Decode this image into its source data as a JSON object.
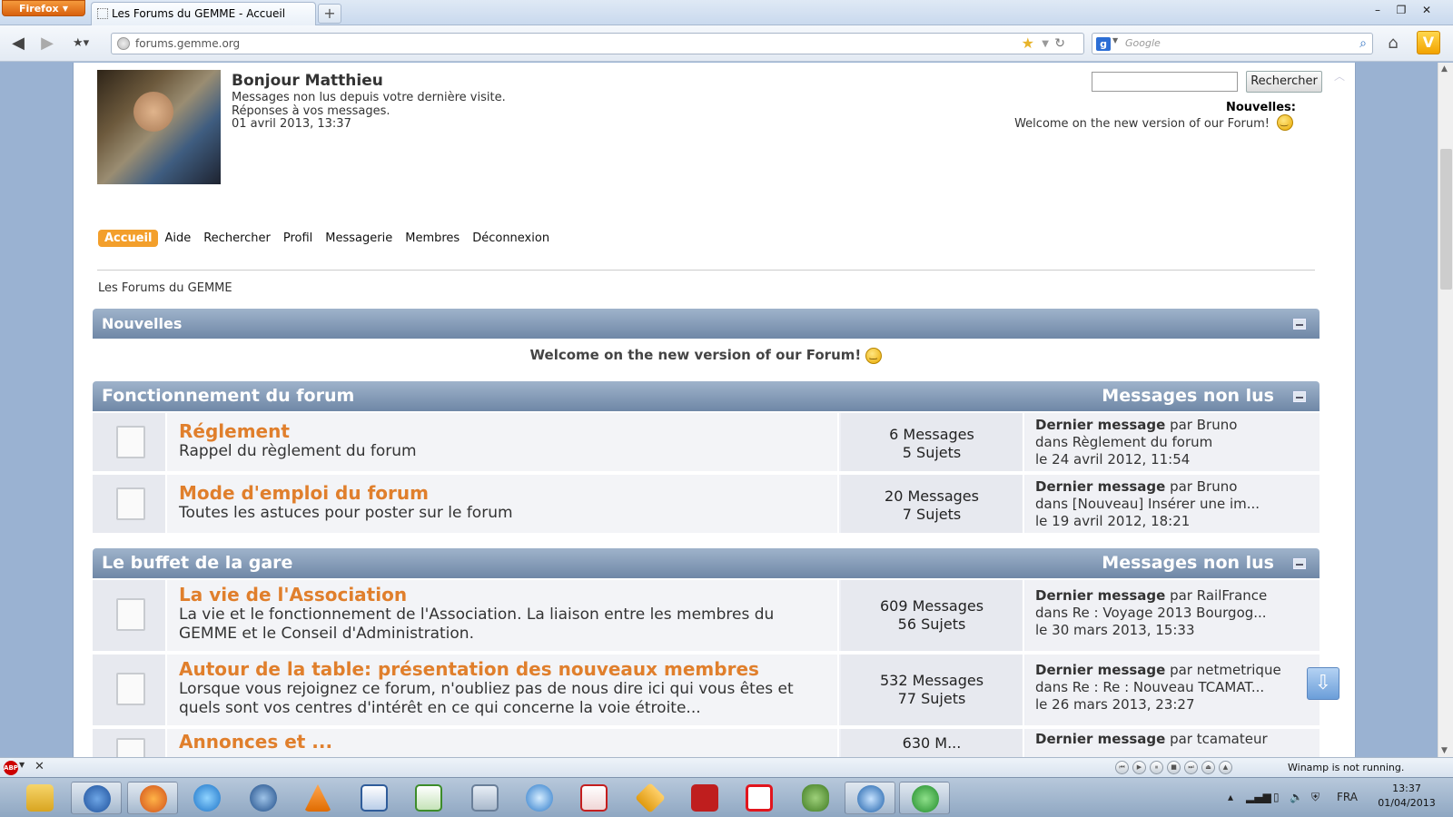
{
  "browser": {
    "app_button": "Firefox",
    "tab_title": "Les Forums du GEMME - Accueil",
    "url": "forums.gemme.org",
    "search_placeholder": "Google",
    "window_controls": [
      "minimize-icon",
      "restore-icon",
      "close-icon"
    ]
  },
  "header": {
    "greeting": "Bonjour Matthieu",
    "unread_link": "Messages non lus depuis votre dernière visite.",
    "replies_link": "Réponses à vos messages.",
    "datetime": "01 avril 2013, 13:37",
    "search_button": "Rechercher",
    "news_label": "Nouvelles:",
    "news_text": "Welcome on the new version of our Forum!"
  },
  "menu": [
    {
      "label": "Accueil",
      "active": true
    },
    {
      "label": "Aide"
    },
    {
      "label": "Rechercher"
    },
    {
      "label": "Profil"
    },
    {
      "label": "Messagerie"
    },
    {
      "label": "Membres"
    },
    {
      "label": "Déconnexion"
    }
  ],
  "breadcrumb": "Les Forums du GEMME",
  "news_section": {
    "title": "Nouvelles",
    "message": "Welcome on the new version of our Forum!"
  },
  "categories": [
    {
      "title": "Fonctionnement du forum",
      "unread_label": "Messages non lus",
      "boards": [
        {
          "title": "Réglement",
          "desc": "Rappel du règlement du forum",
          "messages": "6 Messages",
          "topics": "5 Sujets",
          "last_label": "Dernier message",
          "last_by": " par Bruno",
          "last_in": "dans Règlement du forum",
          "last_date": "le 24 avril 2012, 11:54"
        },
        {
          "title": "Mode d'emploi du forum",
          "desc": "Toutes les astuces pour poster sur le forum",
          "messages": "20 Messages",
          "topics": "7 Sujets",
          "last_label": "Dernier message",
          "last_by": " par Bruno",
          "last_in": "dans [Nouveau] Insérer une im...",
          "last_date": "le 19 avril 2012, 18:21"
        }
      ]
    },
    {
      "title": "Le buffet de la gare",
      "unread_label": "Messages non lus",
      "boards": [
        {
          "title": "La vie de l'Association",
          "desc": "La vie et le fonctionnement de l'Association. La liaison entre les membres du GEMME et le Conseil d'Administration.",
          "messages": "609 Messages",
          "topics": "56 Sujets",
          "last_label": "Dernier message",
          "last_by": " par RailFrance",
          "last_in": "dans Re : Voyage 2013 Bourgog...",
          "last_date": "le 30 mars 2013, 15:33"
        },
        {
          "title": "Autour de la table: présentation des nouveaux membres",
          "desc": "Lorsque vous rejoignez ce forum, n'oubliez pas de nous dire ici qui vous êtes et quels sont vos centres d'intérêt en ce qui concerne la voie étroite...",
          "messages": "532 Messages",
          "topics": "77 Sujets",
          "last_label": "Dernier message",
          "last_by": " par netmetrique",
          "last_in": "dans Re : Re : Nouveau TCAMAT...",
          "last_date": "le 26 mars 2013, 23:27"
        },
        {
          "title": "Annonces et ...",
          "desc": "",
          "messages": "630 M...",
          "topics": "",
          "last_label": "Dernier message",
          "last_by": " par tcamateur",
          "last_in": "",
          "last_date": ""
        }
      ]
    }
  ],
  "addon_bar": {
    "winamp_status": "Winamp is not running."
  },
  "taskbar": {
    "apps": [
      "file-explorer-icon",
      "thunderbird-icon",
      "firefox-icon",
      "internet-explorer-icon",
      "google-earth-icon",
      "vlc-icon",
      "writer-icon",
      "calc-icon",
      "calculator-icon",
      "itunes-icon",
      "acrobat-icon",
      "app-icon",
      "filezilla-icon",
      "db-icon",
      "game-icon",
      "camera-icon",
      "utorrent-icon"
    ],
    "lang": "FRA",
    "time": "13:37",
    "date": "01/04/2013"
  }
}
